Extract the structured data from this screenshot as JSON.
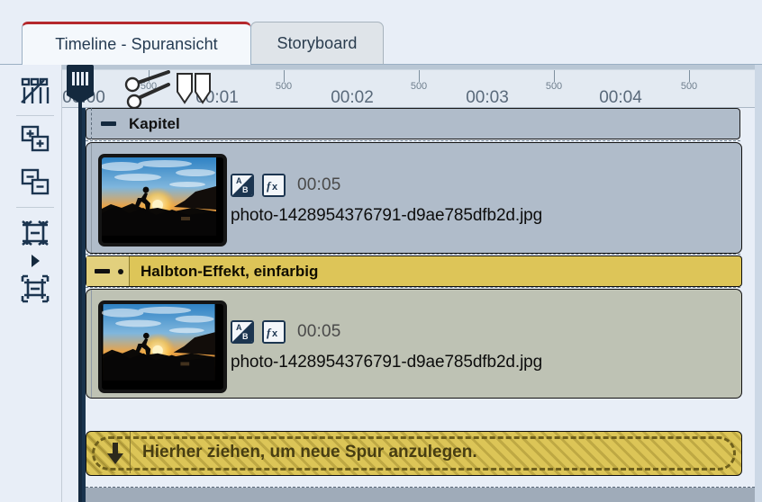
{
  "window": {
    "accent_red": "#b4282c",
    "background": "#e8eef7"
  },
  "tabs": [
    {
      "label": "Timeline - Spuransicht",
      "active": true
    },
    {
      "label": "Storyboard",
      "active": false
    }
  ],
  "toolbar": {
    "items": [
      {
        "name": "storyboard-view-icon",
        "label": "Storyboard-Ansicht"
      },
      {
        "name": "add-track-icon",
        "label": "Spur hinzufügen"
      },
      {
        "name": "remove-track-icon",
        "label": "Spur entfernen"
      },
      {
        "name": "fit-height-icon",
        "label": "Spurhöhe anpassen"
      },
      {
        "name": "expand-arrow-icon",
        "label": "Erweitern"
      },
      {
        "name": "fit-all-icon",
        "label": "Alles einpassen"
      }
    ]
  },
  "ruler": {
    "unit_label": "500",
    "seconds": [
      "00:00",
      "00:01",
      "00:02",
      "00:03",
      "00:04"
    ],
    "ms_labels": [
      "500",
      "500",
      "500",
      "500",
      "500"
    ],
    "playhead_position": "00:00"
  },
  "tracks": {
    "chapter": {
      "label": "Kapitel",
      "color": "#b0bcca"
    },
    "clip1": {
      "duration": "00:05",
      "filename": "photo-1428954376791-d9ae785dfb2d.jpg",
      "badges": [
        "transition-ab-icon",
        "effects-fx-icon"
      ],
      "color": "#b0bcca"
    },
    "effect": {
      "label": "Halbton-Effekt, einfarbig",
      "color": "#ddc558"
    },
    "clip2": {
      "duration": "00:05",
      "filename": "photo-1428954376791-d9ae785dfb2d.jpg",
      "badges": [
        "transition-ab-icon",
        "effects-fx-icon"
      ],
      "color": "#bec2b4"
    },
    "dropzone": {
      "label": "Hierher ziehen, um neue Spur anzulegen.",
      "color": "#dcc557"
    }
  }
}
